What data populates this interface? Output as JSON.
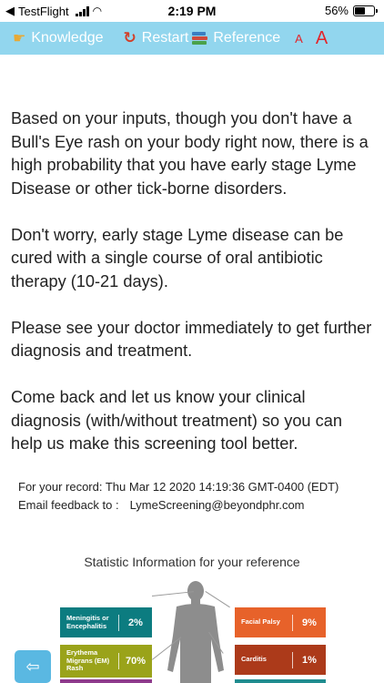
{
  "status_bar": {
    "back_app": "TestFlight",
    "time": "2:19 PM",
    "battery": "56%",
    "battery_level": 0.56
  },
  "nav": {
    "knowledge": "Knowledge",
    "restart": "Restart",
    "reference": "Reference",
    "font_small": "A",
    "font_large": "A"
  },
  "content": {
    "paragraphs": [
      "Based on your inputs, though you don't have a Bull's Eye rash on your body right now, there is a high probability that you have early stage Lyme Disease or other tick-borne disorders.",
      "Don't worry, early stage Lyme disease can be cured with a single course of oral antibiotic therapy (10-21 days).",
      "Please see your doctor immediately to get further diagnosis and treatment.",
      "Come back and let us know your clinical diagnosis (with/without treatment) so you can help us make this screening tool better."
    ],
    "record_label": "For your record: Thu Mar 12 2020 14:19:36 GMT-0400 (EDT)",
    "email_label": "Email feedback to :",
    "email": "LymeScreening@beyondphr.com"
  },
  "stats": {
    "title": "Statistic Information for your reference",
    "items": [
      {
        "label": "Meningitis or Encephalitis",
        "value": "2%",
        "color": "#0c7c80"
      },
      {
        "label": "Erythema Migrans (EM) Rash",
        "value": "70%",
        "color": "#9aa31a"
      },
      {
        "label": "Facial Palsy",
        "value": "9%",
        "color": "#e7622a"
      },
      {
        "label": "Carditis",
        "value": "1%",
        "color": "#ac3a1a"
      }
    ]
  },
  "colors": {
    "nav_bg": "#92d6ee",
    "accent_red": "#e2262b",
    "button_blue": "#5ab8e2"
  }
}
